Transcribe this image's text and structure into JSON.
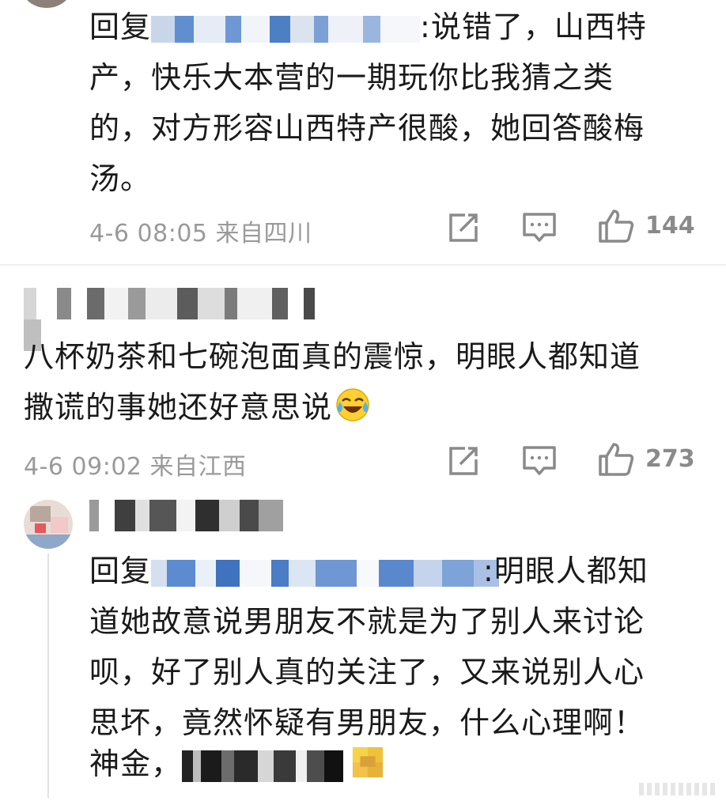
{
  "reply1": {
    "reply_prefix": "回复",
    "lines": [
      ":说错了，山西特",
      "产，快乐大本营的一期玩你比我猜之类",
      "的，对方形容山西特产很酸，她回答酸梅",
      "汤。"
    ],
    "meta": "4-6 08:05 来自四川",
    "likes": "144"
  },
  "comment2": {
    "lines": [
      "八杯奶茶和七碗泡面真的震惊，明眼人都知道",
      "撒谎的事她还好意思说"
    ],
    "emoji": "laugh-cry-emoji",
    "meta": "4-6 09:02 来自江西",
    "likes": "273"
  },
  "reply3": {
    "reply_prefix": "回复",
    "lines": [
      ":明眼人都知",
      "道她故意说男朋友不就是为了别人来讨论",
      "呗，好了别人真的关注了，又来说别人心",
      "思坏，竟然怀疑有男朋友，什么心理啊！",
      "神金，"
    ],
    "emoji": "laugh-cry-emoji"
  },
  "icons": {
    "share": "share-icon",
    "comment": "comment-icon",
    "like": "thumbs-up-icon"
  },
  "colors": {
    "text": "#1a1a1a",
    "meta": "#9a9a9a",
    "icon": "#8a8a8a"
  }
}
